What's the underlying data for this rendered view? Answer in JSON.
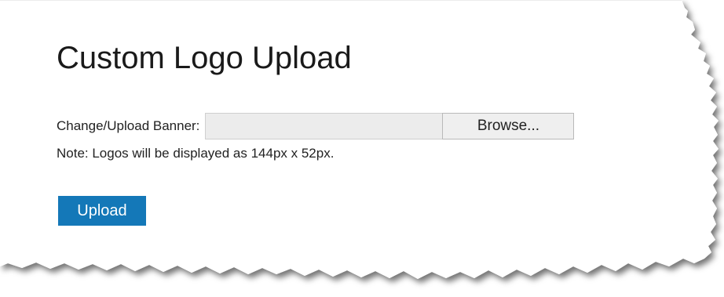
{
  "page": {
    "title": "Custom Logo Upload",
    "banner_label": "Change/Upload Banner:",
    "file_path_value": "",
    "browse_label": "Browse...",
    "note": "Note: Logos will be displayed as 144px x 52px.",
    "upload_label": "Upload"
  },
  "colors": {
    "upload_button": "#1478b8",
    "file_input_background": "#ececec",
    "browse_button_background": "#efefef",
    "text": "#222222"
  }
}
